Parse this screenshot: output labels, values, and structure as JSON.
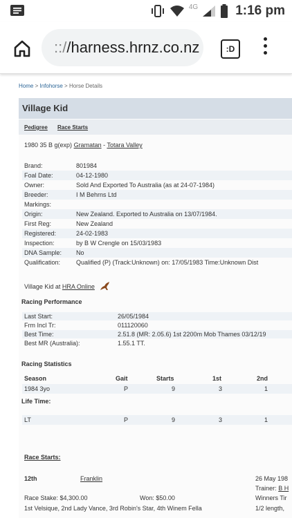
{
  "status_bar": {
    "time": "1:16 pm",
    "network": "4G",
    "icons": [
      "notification-icon",
      "vibrate-icon",
      "wifi-icon",
      "signal-icon",
      "battery-icon"
    ]
  },
  "browser": {
    "url_prefix": "::/",
    "url_host": "/harness.hrnz.co.nz",
    "tabs_glyph": ":D"
  },
  "breadcrumb": {
    "home": "Home",
    "sep1": " > ",
    "infohorse": "Infohorse",
    "sep2": " > ",
    "current": "Horse Details"
  },
  "horse": {
    "name": "Village Kid",
    "tabs": [
      "Pedigree",
      "Race Starts"
    ],
    "desc_prefix": "1980 35 B g(exp) ",
    "sire": "Gramatan",
    "desc_sep": " - ",
    "dam": "Totara Valley"
  },
  "details": [
    {
      "label": "Brand:",
      "value": "801984"
    },
    {
      "label": "Foal Date:",
      "value": "04-12-1980"
    },
    {
      "label": "Owner:",
      "value": "Sold And Exported To Australia    (as at 24-07-1984)"
    },
    {
      "label": "Breeder:",
      "value": "I M Behrns Ltd"
    },
    {
      "label": "Markings:",
      "value": ""
    },
    {
      "label": "Origin:",
      "value": "New Zealand.    Exported to Australia on 13/07/1984."
    },
    {
      "label": "First Reg:",
      "value": "New Zealand"
    },
    {
      "label": "Registered:",
      "value": "24-02-1983"
    },
    {
      "label": "Inspection:",
      "value": "by B W Crengle on 15/03/1983"
    },
    {
      "label": "DNA Sample:",
      "value": "No"
    },
    {
      "label": "Qualification:",
      "value": "Qualified (P) (Track:Unknown) on: 17/05/1983 Time:Unknown Dist"
    }
  ],
  "hra": {
    "prefix": "Village Kid at ",
    "link": "HRA Online"
  },
  "racing_performance": {
    "heading": "Racing Performance",
    "rows": [
      {
        "label": "Last Start:",
        "value": "26/05/1984"
      },
      {
        "label": "Frm Incl Tr:",
        "value": "011120060"
      },
      {
        "label": "Best Time:",
        "value": "2.51.8 (MR: 2.05.6) 1st 2200m Mob Thames 03/12/19"
      },
      {
        "label": "Best MR (Australia):",
        "value": "1.55.1 TT."
      }
    ]
  },
  "racing_statistics": {
    "heading": "Racing Statistics",
    "columns": [
      "Season",
      "Gait",
      "Starts",
      "1st",
      "2nd"
    ],
    "rows": [
      {
        "season": "1984 3yo",
        "gait": "P",
        "starts": "9",
        "first": "3",
        "second": "1"
      }
    ],
    "lifetime_heading": "Life Time:",
    "lifetime": {
      "season": "LT",
      "gait": "P",
      "starts": "9",
      "first": "3",
      "second": "1"
    }
  },
  "race_starts": {
    "heading": "Race Starts:",
    "entry": {
      "place": "12th",
      "track": "Franklin",
      "date": "26 May 198",
      "trainer_prefix": "Trainer: ",
      "trainer": "B H",
      "winners": "Winners Tir",
      "stake": "Race Stake: $4,300.00",
      "won": "Won: $50.00",
      "placings": "1st Velsique, 2nd Lady Vance, 3rd Robin's Star, 4th Winem Fella",
      "margin": "1/2 length,"
    }
  }
}
